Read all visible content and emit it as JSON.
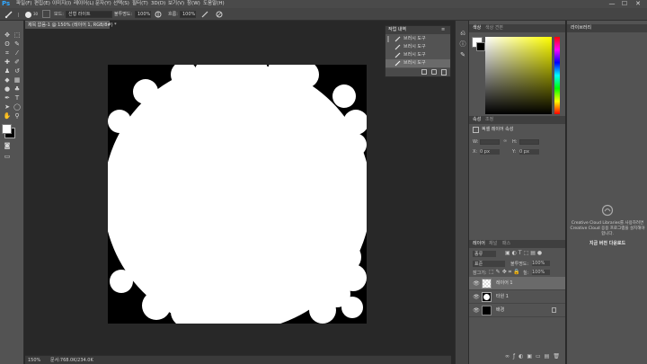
{
  "app": {
    "logo": "Ps"
  },
  "menu": [
    "파일(F)",
    "편집(E)",
    "이미지(I)",
    "레이어(L)",
    "문자(Y)",
    "선택(S)",
    "필터(T)",
    "3D(D)",
    "보기(V)",
    "창(W)",
    "도움말(H)"
  ],
  "window_controls": {
    "minimize": "—",
    "maximize": "☐",
    "close": "✕"
  },
  "options": {
    "mode_label": "모드:",
    "mode_value": "선형 라이트",
    "opacity_label": "불투명도:",
    "opacity_value": "100%",
    "flow_label": "흐름:",
    "flow_value": "100%",
    "brush_size": "30"
  },
  "document": {
    "tab_title": "제목 없음-1 @ 150% (레이어 1, RGB/8#) *"
  },
  "status": {
    "zoom": "150%",
    "doc_info": "문서:768.0K/234.0K"
  },
  "history": {
    "title": "작업 내역",
    "items": [
      "브러시 도구",
      "브러시 도구",
      "브러시 도구",
      "브러시 도구"
    ]
  },
  "color_panel": {
    "tabs": [
      "색상",
      "색상 견본"
    ]
  },
  "props_panel": {
    "tabs": [
      "속성",
      "조정"
    ],
    "section_title": "픽셀 레이어 속성",
    "w_label": "W:",
    "h_label": "H:",
    "x_label": "X:",
    "x_value": "0 px",
    "y_label": "Y:",
    "y_value": "0 px"
  },
  "layers_panel": {
    "tabs": [
      "레이어",
      "채널",
      "패스"
    ],
    "kind_label": "종류",
    "blend_value": "표준",
    "opacity_label": "불투명도:",
    "opacity_value": "100%",
    "lock_label": "잠그기:",
    "fill_label": "칠:",
    "fill_value": "100%",
    "layers": [
      {
        "name": "레이어 1",
        "thumb": "checker",
        "selected": true
      },
      {
        "name": "타원 1",
        "thumb": "shape",
        "selected": false
      },
      {
        "name": "배경",
        "thumb": "black",
        "selected": false
      }
    ]
  },
  "libraries": {
    "tab": "라이브러리",
    "message_line1": "Creative Cloud Libraries를 사용하려면",
    "message_line2": "Creative Cloud 응용 프로그램을 설치해야",
    "message_line3": "합니다.",
    "link": "지금 버전 다운로드"
  },
  "colors": {
    "accent": "#31a8ff",
    "foreground": "#ffffff",
    "background": "#000000",
    "picker_hue": "#ffff00"
  }
}
